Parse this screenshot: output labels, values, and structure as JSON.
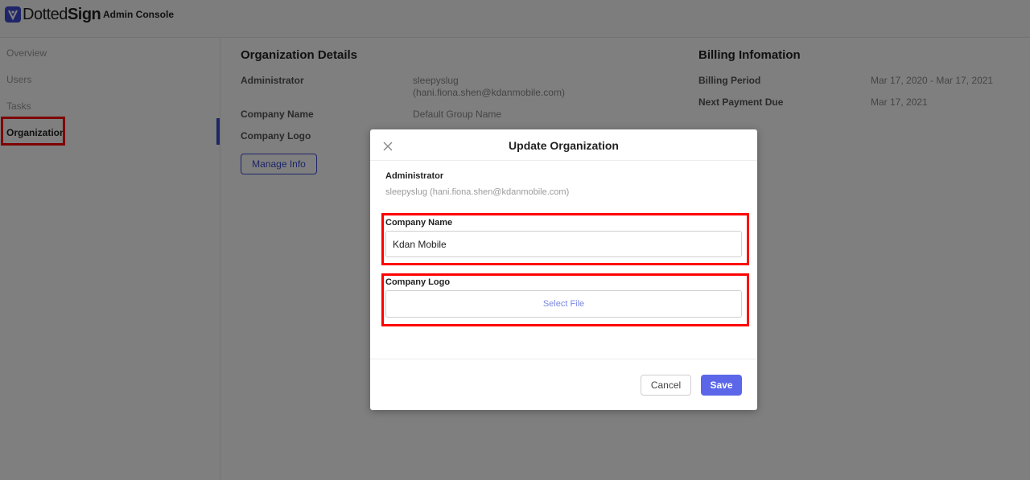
{
  "header": {
    "logo": {
      "light": "Dotted",
      "bold": "Sign"
    },
    "console_title": "Admin Console"
  },
  "sidebar": {
    "items": [
      {
        "label": "Overview"
      },
      {
        "label": "Users"
      },
      {
        "label": "Tasks"
      },
      {
        "label": "Organization",
        "active": true
      }
    ],
    "accent_color": "#3c4bd1"
  },
  "org_details": {
    "title": "Organization Details",
    "administrator_label": "Administrator",
    "administrator_name": "sleepyslug",
    "administrator_email": "(hani.fiona.shen@kdanmobile.com)",
    "company_name_label": "Company Name",
    "company_name_value": "Default Group Name",
    "company_logo_label": "Company Logo",
    "manage_button": "Manage Info"
  },
  "billing": {
    "title": "Billing Infomation",
    "period_label": "Billing Period",
    "period_value": "Mar 17, 2020 - Mar 17, 2021",
    "next_due_label": "Next Payment Due",
    "next_due_value": "Mar 17, 2021"
  },
  "modal": {
    "title": "Update Organization",
    "close_icon": "close-icon",
    "administrator_label": "Administrator",
    "administrator_value": "sleepyslug (hani.fiona.shen@kdanmobile.com)",
    "company_name_label": "Company Name",
    "company_name_value": "Kdan Mobile",
    "company_logo_label": "Company Logo",
    "select_file": "Select File",
    "cancel": "Cancel",
    "save": "Save",
    "save_color": "#5b67e8"
  },
  "highlight_color": "#ff0000"
}
